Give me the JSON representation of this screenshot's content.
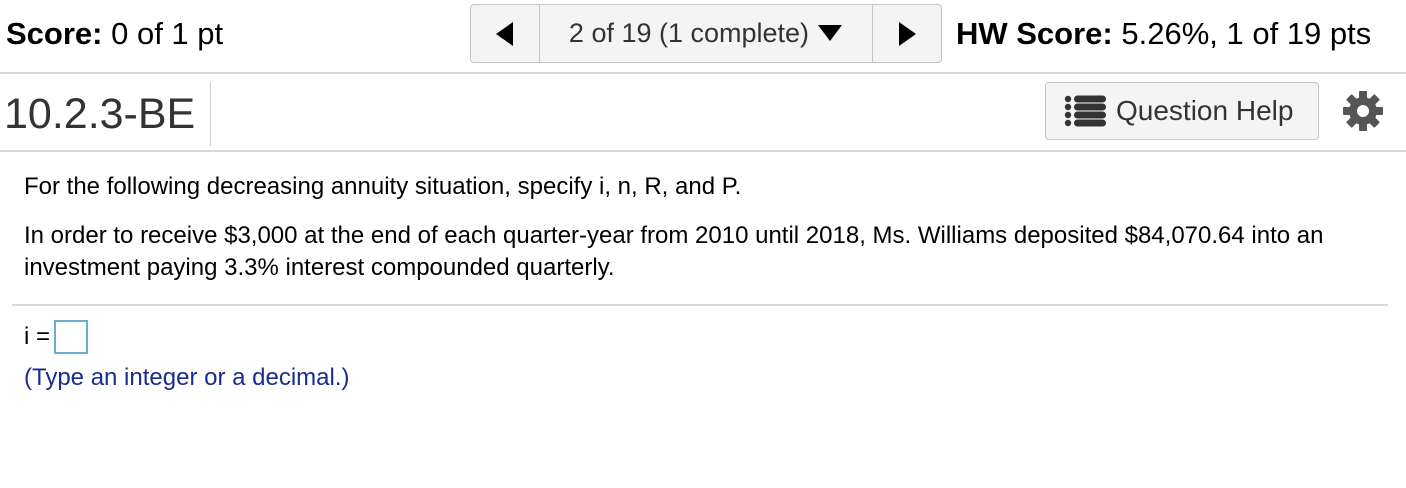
{
  "header": {
    "score_label": "Score:",
    "score_value": "0 of 1 pt",
    "nav_progress": "2 of 19 (1 complete)",
    "hw_score_label": "HW Score:",
    "hw_score_value": "5.26%, 1 of 19 pts"
  },
  "question": {
    "id": "10.2.3-BE",
    "help_label": "Question Help",
    "intro": "For the following decreasing annuity situation, specify i, n, R, and P.",
    "problem": "In order to receive $3,000 at the end of each quarter-year from 2010 until 2018, Ms. Williams deposited $84,070.64 into an investment paying 3.3% interest compounded quarterly.",
    "answer_label": "i =",
    "answer_value": "",
    "hint": "(Type an integer or a decimal.)"
  },
  "icons": {
    "prev": "triangle-left-icon",
    "next": "triangle-right-icon",
    "dropdown": "caret-down-icon",
    "help": "list-icon",
    "settings": "gear-icon"
  },
  "colors": {
    "hint_text": "#1a2c8c",
    "input_border": "#6aaecf"
  }
}
